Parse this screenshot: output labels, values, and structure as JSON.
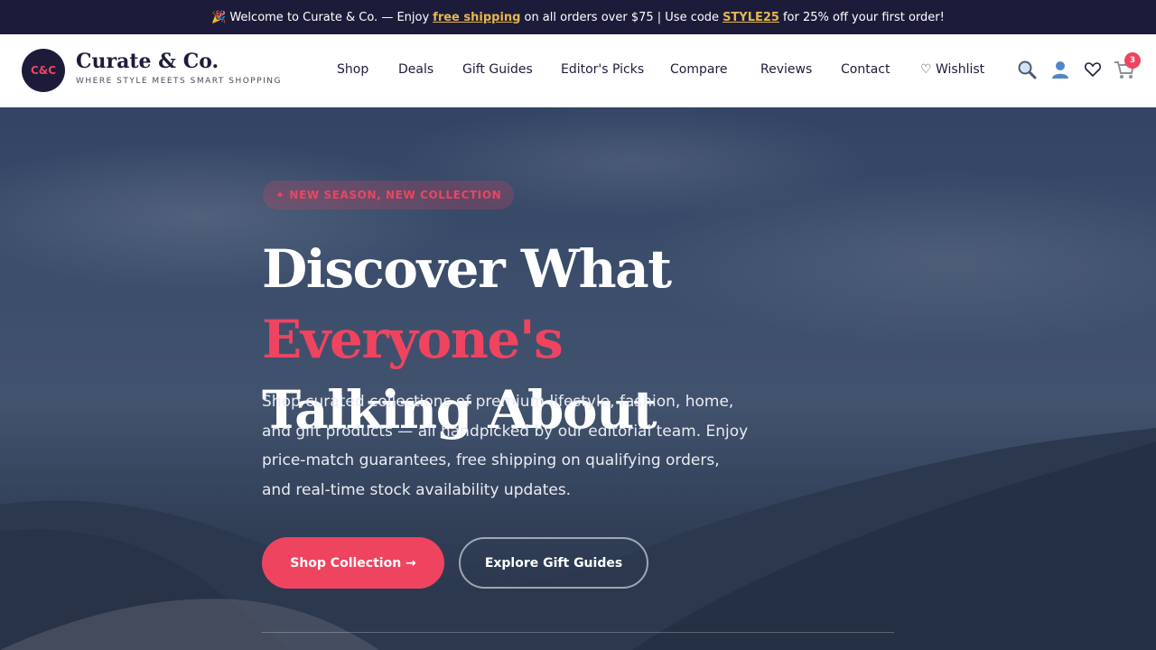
{
  "announcement": {
    "emoji": "🎉",
    "text_1": "Welcome to Curate & Co. — Enjoy",
    "highlight_1": "free shipping",
    "text_2": "on all orders over $75 | Use code",
    "highlight_2": "STYLE25",
    "text_3": "for 25% off your first order!"
  },
  "brand": {
    "badge": "C&C",
    "name": "Curate & Co.",
    "tagline": "WHERE STYLE MEETS SMART SHOPPING"
  },
  "nav": {
    "items": [
      "Shop",
      "Deals",
      "Gift Guides",
      "Editor's Picks",
      "Compare",
      "Reviews",
      "Contact",
      "♡ Wishlist"
    ]
  },
  "header_icons": {
    "search": "search-icon",
    "account": "user-icon",
    "wishlist": "heart-icon",
    "cart": "cart-icon",
    "cart_count": "3"
  },
  "hero": {
    "eyebrow": "✦ NEW SEASON, NEW COLLECTION",
    "headline_1": "Discover What",
    "headline_accent": "Everyone's",
    "headline_2": "Talking About",
    "subtext": "Shop curated collections of premium lifestyle, fashion, home, and gift products — all handpicked by our editorial team. Enjoy price-match guarantees, free shipping on qualifying orders, and real-time stock availability updates.",
    "primary_cta": "Shop Collection →",
    "secondary_cta": "Explore Gift Guides"
  },
  "colors": {
    "navy": "#1c1c3a",
    "accent": "#ef4460",
    "gold": "#e8b74a"
  }
}
